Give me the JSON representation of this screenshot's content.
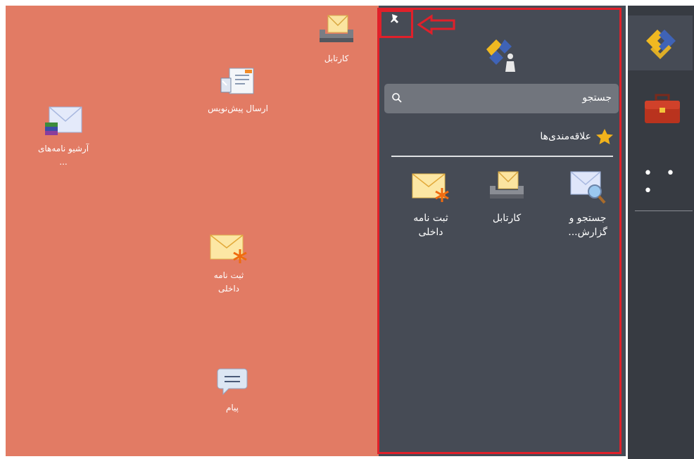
{
  "desktop": {
    "icons": [
      {
        "id": "cartable",
        "label": "کارتابل",
        "icon": "inbox-tray-icon"
      },
      {
        "id": "send-draft",
        "label": "ارسال پیش‌نویس",
        "icon": "draft-send-icon"
      },
      {
        "id": "archive",
        "label": "آرشیو نامه‌های ...",
        "icon": "archive-mail-icon"
      },
      {
        "id": "internal-letter",
        "label": "ثبت نامه داخلی",
        "icon": "new-letter-icon"
      },
      {
        "id": "message",
        "label": "پیام",
        "icon": "chat-bubble-icon"
      }
    ]
  },
  "panel": {
    "search_placeholder": "جستجو",
    "favorites_title": "علاقه‌مندی‌ها",
    "favorites": [
      {
        "id": "search-report",
        "label": "جستجو و گزارش...",
        "icon": "search-mail-icon"
      },
      {
        "id": "cartable",
        "label": "کارتابل",
        "icon": "inbox-tray-icon"
      },
      {
        "id": "internal-letter",
        "label": "ثبت نامه داخلی",
        "icon": "new-letter-icon"
      }
    ]
  },
  "rail": {
    "items": [
      {
        "id": "app",
        "icon": "app-logo-icon"
      },
      {
        "id": "briefcase",
        "icon": "briefcase-icon"
      },
      {
        "id": "more",
        "icon": "more-dots-icon",
        "label": "• • •"
      }
    ]
  },
  "colors": {
    "desktop_bg": "#e27b64",
    "panel_bg": "#464b55",
    "rail_bg": "#373b42",
    "highlight": "#e0202a"
  }
}
